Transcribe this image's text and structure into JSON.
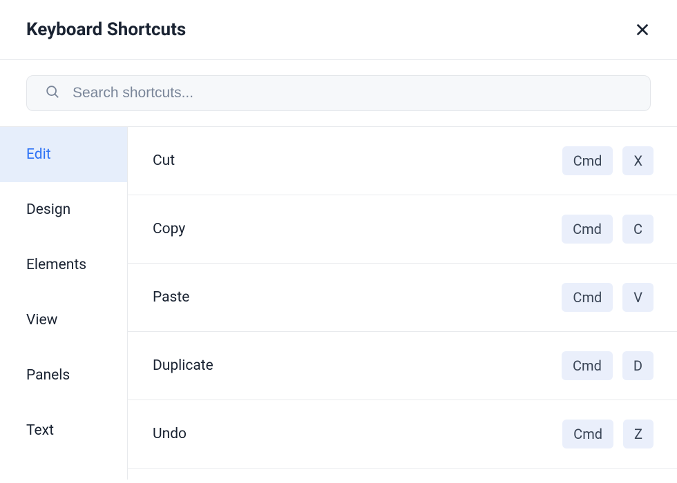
{
  "header": {
    "title": "Keyboard Shortcuts"
  },
  "search": {
    "placeholder": "Search shortcuts..."
  },
  "sidebar": {
    "tabs": [
      {
        "label": "Edit",
        "active": true
      },
      {
        "label": "Design",
        "active": false
      },
      {
        "label": "Elements",
        "active": false
      },
      {
        "label": "View",
        "active": false
      },
      {
        "label": "Panels",
        "active": false
      },
      {
        "label": "Text",
        "active": false
      }
    ]
  },
  "shortcuts": [
    {
      "label": "Cut",
      "keys": [
        "Cmd",
        "X"
      ]
    },
    {
      "label": "Copy",
      "keys": [
        "Cmd",
        "C"
      ]
    },
    {
      "label": "Paste",
      "keys": [
        "Cmd",
        "V"
      ]
    },
    {
      "label": "Duplicate",
      "keys": [
        "Cmd",
        "D"
      ]
    },
    {
      "label": "Undo",
      "keys": [
        "Cmd",
        "Z"
      ]
    }
  ]
}
